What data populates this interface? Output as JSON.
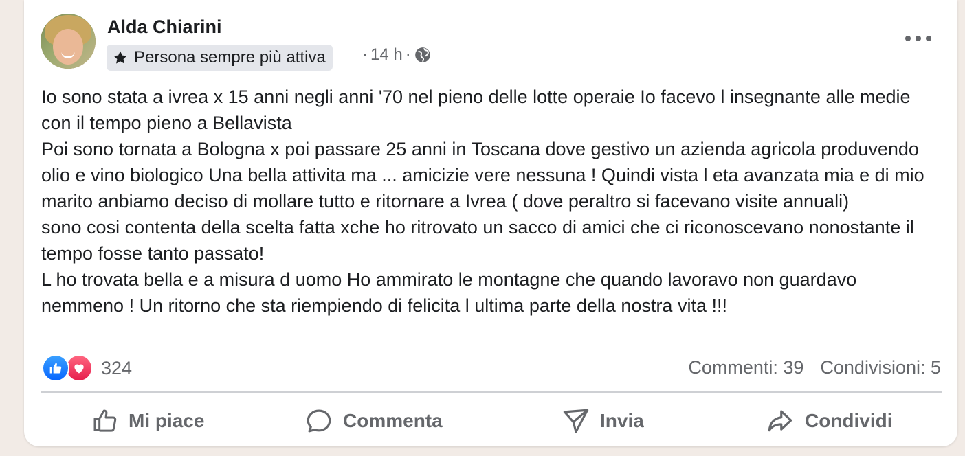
{
  "post": {
    "author": "Alda Chiarini",
    "badge": "Persona sempre più attiva",
    "time": "14 h",
    "paragraphs": [
      "Io sono stata a ivrea x 15 anni negli anni '70 nel pieno delle lotte operaie Io facevo l insegnante alle medie con il tempo pieno a Bellavista",
      "Poi sono tornata a Bologna x poi passare 25 anni in Toscana dove gestivo un azienda agricola produvendo olio e vino biologico Una bella attivita ma ... amicizie vere nessuna ! Quindi vista l eta avanzata mia e di mio marito anbiamo deciso di mollare tutto e ritornare a Ivrea ( dove peraltro si facevano visite annuali)",
      "sono cosi contenta della scelta fatta xche ho ritrovato un sacco di amici che ci riconoscevano nonostante il tempo fosse tanto passato!",
      "L ho trovata bella e a misura d uomo Ho ammirato le montagne che quando lavoravo non guardavo nemmeno ! Un ritorno che sta riempiendo  di felicita l ultima parte della nostra vita !!!"
    ]
  },
  "engagement": {
    "reaction_count": "324",
    "comments": "Commenti: 39",
    "shares": "Condivisioni: 5"
  },
  "actions": {
    "like": "Mi piace",
    "comment": "Commenta",
    "send": "Invia",
    "share": "Condividi"
  },
  "colors": {
    "like_blue": "#0866ff",
    "love_red": "#e61e4d",
    "muted_text": "#65676b"
  }
}
